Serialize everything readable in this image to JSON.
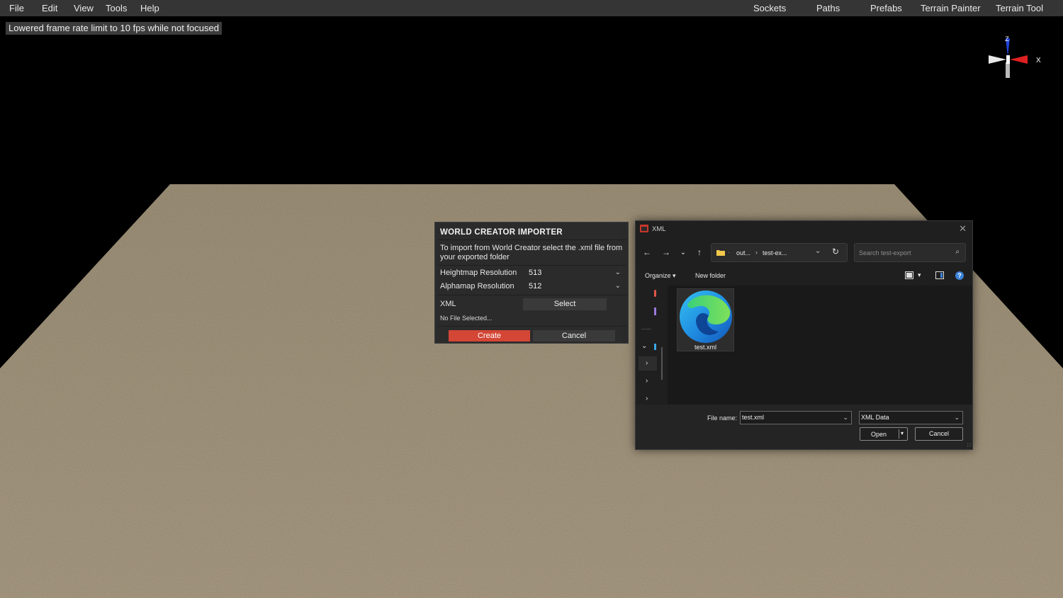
{
  "menu": {
    "left": [
      "File",
      "Edit",
      "View",
      "Tools",
      "Help"
    ],
    "right": [
      "Sockets",
      "Paths",
      "Prefabs",
      "Terrain Painter",
      "Terrain Tool"
    ]
  },
  "notice": "Lowered frame rate limit to 10 fps while not focused",
  "gizmo": {
    "z_label": "Z",
    "x_label": "X"
  },
  "importer": {
    "title": "WORLD CREATOR IMPORTER",
    "description": "To import from World Creator select the .xml file from your exported folder",
    "heightmap_label": "Heightmap Resolution",
    "heightmap_value": "513",
    "alphamap_label": "Alphamap Resolution",
    "alphamap_value": "512",
    "xml_label": "XML",
    "select_label": "Select",
    "no_file": "No File Selected...",
    "create_label": "Create",
    "cancel_label": "Cancel"
  },
  "file_dialog": {
    "title": "XML",
    "breadcrumb": [
      "out...",
      "test-ex..."
    ],
    "search_placeholder": "Search test-export",
    "organize_label": "Organize",
    "new_folder_label": "New folder",
    "help_glyph": "?",
    "file": {
      "name": "test.xml",
      "icon": "edge-browser-icon"
    },
    "file_name_label": "File name:",
    "file_name_value": "test.xml",
    "file_type_value": "XML Data",
    "open_label": "Open",
    "cancel_label": "Cancel"
  },
  "colors": {
    "create_button": "#d44636",
    "terrain": "#a89a80",
    "menubar": "#353535"
  }
}
